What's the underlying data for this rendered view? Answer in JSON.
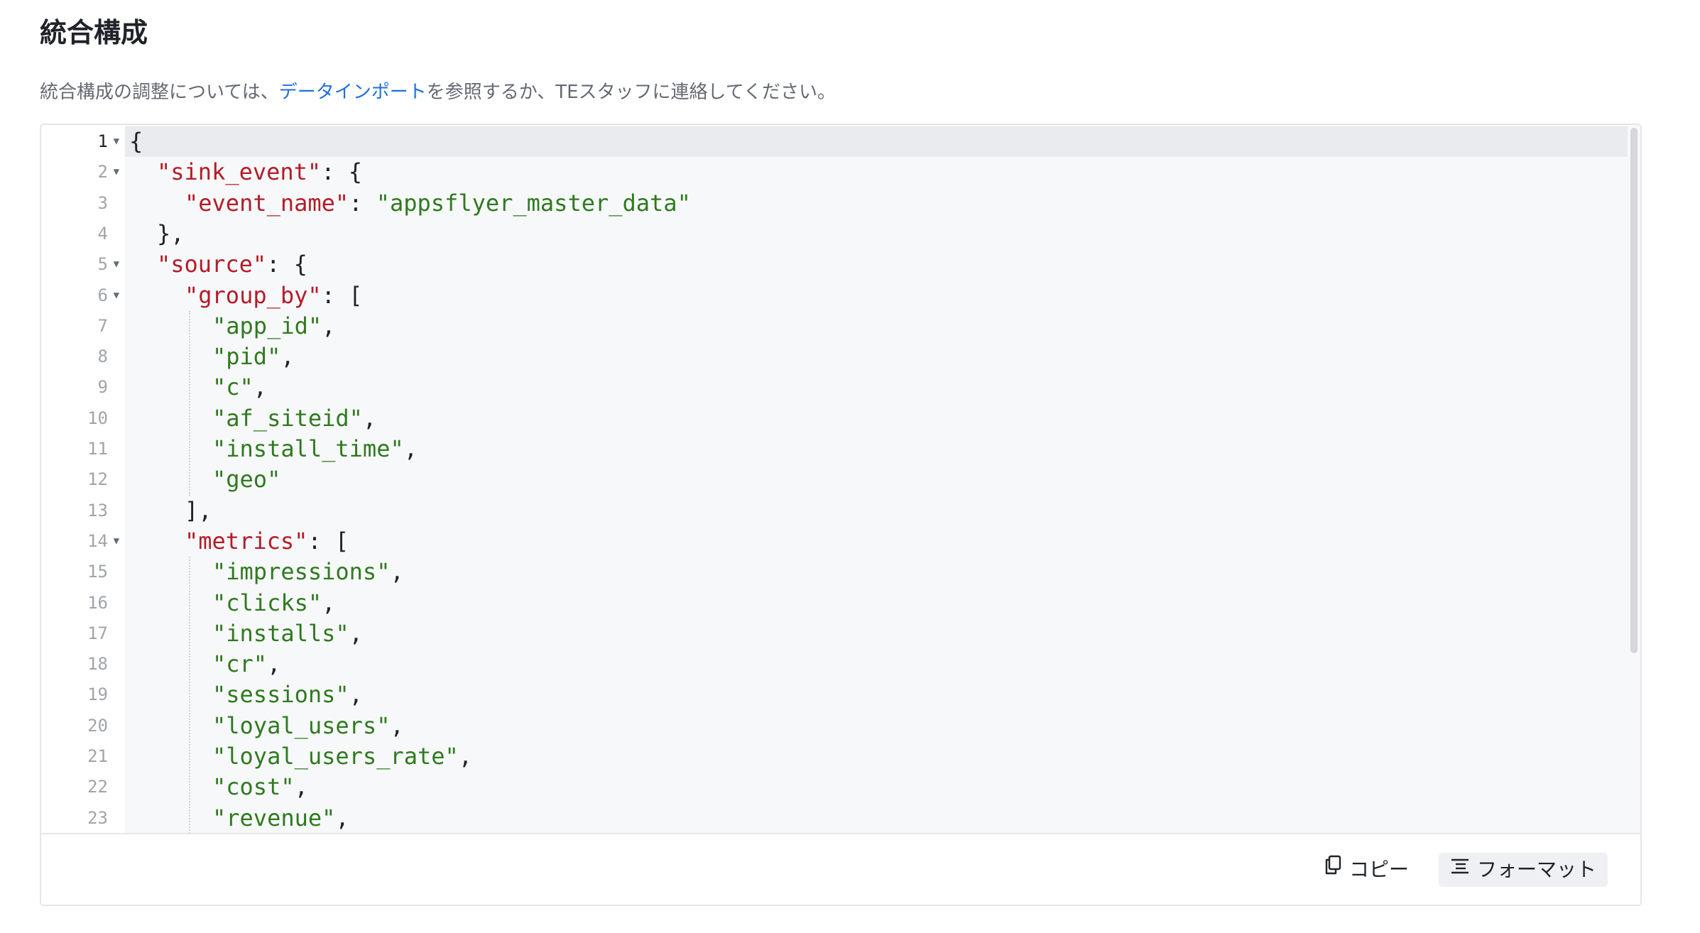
{
  "header": {
    "title": "統合構成"
  },
  "description": {
    "prefix": "統合構成の調整については、",
    "link_text": "データインポート",
    "suffix": "を参照するか、TEスタッフに連絡してください。"
  },
  "editor": {
    "active_line": 1,
    "lines": [
      {
        "n": "1",
        "fold": true,
        "indent": 0,
        "tokens": [
          {
            "t": "p",
            "v": "{"
          }
        ]
      },
      {
        "n": "2",
        "fold": true,
        "indent": 1,
        "tokens": [
          {
            "t": "k",
            "v": "\"sink_event\""
          },
          {
            "t": "p",
            "v": ": {"
          }
        ]
      },
      {
        "n": "3",
        "fold": false,
        "indent": 2,
        "tokens": [
          {
            "t": "k",
            "v": "\"event_name\""
          },
          {
            "t": "p",
            "v": ": "
          },
          {
            "t": "s",
            "v": "\"appsflyer_master_data\""
          }
        ]
      },
      {
        "n": "4",
        "fold": false,
        "indent": 1,
        "tokens": [
          {
            "t": "p",
            "v": "},"
          }
        ]
      },
      {
        "n": "5",
        "fold": true,
        "indent": 1,
        "tokens": [
          {
            "t": "k",
            "v": "\"source\""
          },
          {
            "t": "p",
            "v": ": {"
          }
        ]
      },
      {
        "n": "6",
        "fold": true,
        "indent": 2,
        "tokens": [
          {
            "t": "k",
            "v": "\"group_by\""
          },
          {
            "t": "p",
            "v": ": ["
          }
        ]
      },
      {
        "n": "7",
        "fold": false,
        "indent": 3,
        "tokens": [
          {
            "t": "s",
            "v": "\"app_id\""
          },
          {
            "t": "p",
            "v": ","
          }
        ]
      },
      {
        "n": "8",
        "fold": false,
        "indent": 3,
        "tokens": [
          {
            "t": "s",
            "v": "\"pid\""
          },
          {
            "t": "p",
            "v": ","
          }
        ]
      },
      {
        "n": "9",
        "fold": false,
        "indent": 3,
        "tokens": [
          {
            "t": "s",
            "v": "\"c\""
          },
          {
            "t": "p",
            "v": ","
          }
        ]
      },
      {
        "n": "10",
        "fold": false,
        "indent": 3,
        "tokens": [
          {
            "t": "s",
            "v": "\"af_siteid\""
          },
          {
            "t": "p",
            "v": ","
          }
        ]
      },
      {
        "n": "11",
        "fold": false,
        "indent": 3,
        "tokens": [
          {
            "t": "s",
            "v": "\"install_time\""
          },
          {
            "t": "p",
            "v": ","
          }
        ]
      },
      {
        "n": "12",
        "fold": false,
        "indent": 3,
        "tokens": [
          {
            "t": "s",
            "v": "\"geo\""
          }
        ]
      },
      {
        "n": "13",
        "fold": false,
        "indent": 2,
        "tokens": [
          {
            "t": "p",
            "v": "],"
          }
        ]
      },
      {
        "n": "14",
        "fold": true,
        "indent": 2,
        "tokens": [
          {
            "t": "k",
            "v": "\"metrics\""
          },
          {
            "t": "p",
            "v": ": ["
          }
        ]
      },
      {
        "n": "15",
        "fold": false,
        "indent": 3,
        "tokens": [
          {
            "t": "s",
            "v": "\"impressions\""
          },
          {
            "t": "p",
            "v": ","
          }
        ]
      },
      {
        "n": "16",
        "fold": false,
        "indent": 3,
        "tokens": [
          {
            "t": "s",
            "v": "\"clicks\""
          },
          {
            "t": "p",
            "v": ","
          }
        ]
      },
      {
        "n": "17",
        "fold": false,
        "indent": 3,
        "tokens": [
          {
            "t": "s",
            "v": "\"installs\""
          },
          {
            "t": "p",
            "v": ","
          }
        ]
      },
      {
        "n": "18",
        "fold": false,
        "indent": 3,
        "tokens": [
          {
            "t": "s",
            "v": "\"cr\""
          },
          {
            "t": "p",
            "v": ","
          }
        ]
      },
      {
        "n": "19",
        "fold": false,
        "indent": 3,
        "tokens": [
          {
            "t": "s",
            "v": "\"sessions\""
          },
          {
            "t": "p",
            "v": ","
          }
        ]
      },
      {
        "n": "20",
        "fold": false,
        "indent": 3,
        "tokens": [
          {
            "t": "s",
            "v": "\"loyal_users\""
          },
          {
            "t": "p",
            "v": ","
          }
        ]
      },
      {
        "n": "21",
        "fold": false,
        "indent": 3,
        "tokens": [
          {
            "t": "s",
            "v": "\"loyal_users_rate\""
          },
          {
            "t": "p",
            "v": ","
          }
        ]
      },
      {
        "n": "22",
        "fold": false,
        "indent": 3,
        "tokens": [
          {
            "t": "s",
            "v": "\"cost\""
          },
          {
            "t": "p",
            "v": ","
          }
        ]
      },
      {
        "n": "23",
        "fold": false,
        "indent": 3,
        "tokens": [
          {
            "t": "s",
            "v": "\"revenue\""
          },
          {
            "t": "p",
            "v": ","
          }
        ]
      }
    ]
  },
  "toolbar": {
    "copy_label": "コピー",
    "copy_icon": "copy-icon",
    "format_label": "フォーマット",
    "format_icon": "format-align-icon"
  },
  "colors": {
    "link": "#1f6fe0",
    "json_key": "#b31d28",
    "json_string": "#2f7a1f",
    "editor_bg": "#f7f8fa"
  }
}
